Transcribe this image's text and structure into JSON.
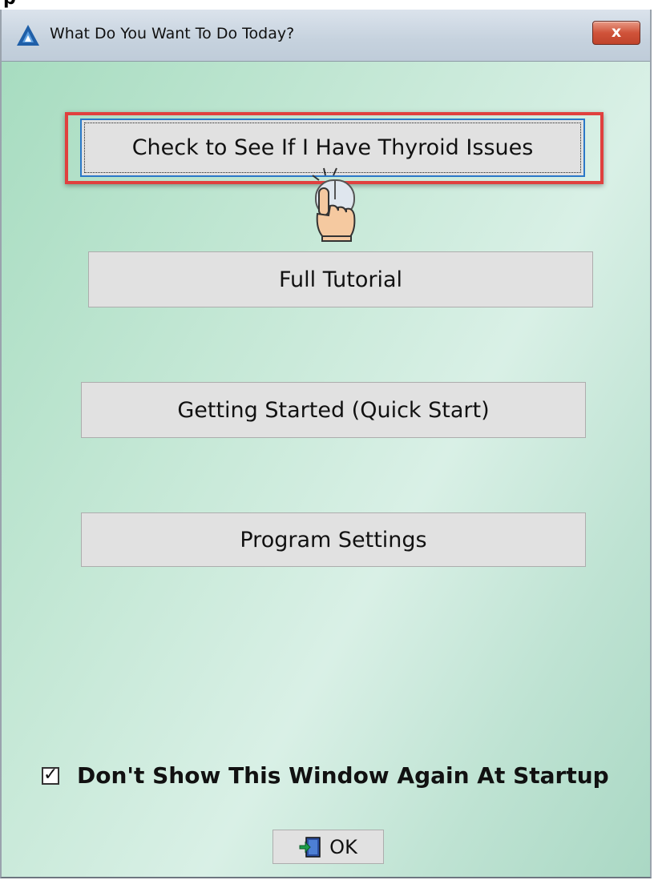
{
  "window": {
    "title": "What Do You Want To Do Today?",
    "close_label": "x",
    "top_strip_text": "p"
  },
  "buttons": {
    "thyroid_check": "Check to See If I Have Thyroid Issues",
    "full_tutorial": "Full Tutorial",
    "getting_started": "Getting Started (Quick Start)",
    "program_settings": "Program Settings"
  },
  "startup_option": {
    "label": "Don't Show This Window Again At Startup",
    "checked": true,
    "check_mark": "✓"
  },
  "ok_button": {
    "label": "OK",
    "icon": "exit-door-icon"
  },
  "icons": {
    "app": "app-logo-icon",
    "cursor": "hand-cursor-icon"
  },
  "colors": {
    "highlight": "#e0403e",
    "focus_border": "#2a78c8",
    "close_button": "#d0533a",
    "background": "#c5e8d6"
  }
}
